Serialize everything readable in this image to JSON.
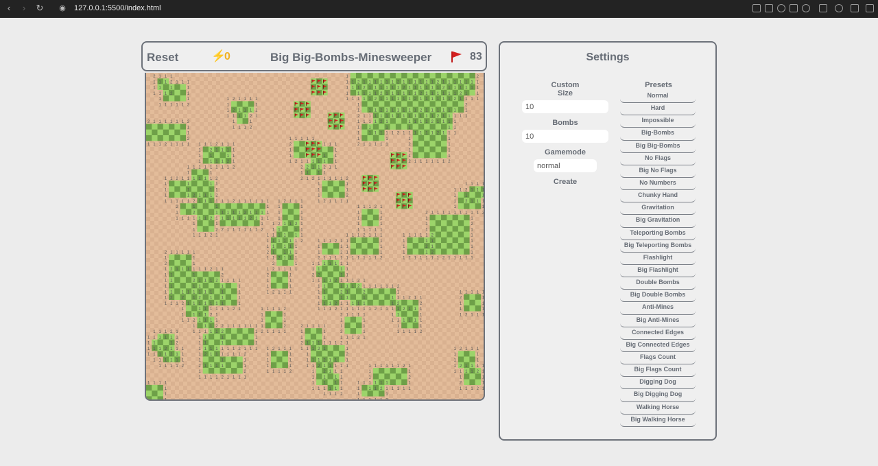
{
  "browser": {
    "url": "127.0.0.1:5500/index.html"
  },
  "topbar": {
    "reset_label": "Reset",
    "lightning_count": "0",
    "title": "Big Big-Bombs-Minesweeper",
    "flags_left": "83"
  },
  "settings": {
    "title": "Settings",
    "custom": {
      "heading": "Custom",
      "size_label": "Size",
      "size_value": "10",
      "bombs_label": "Bombs",
      "bombs_value": "10",
      "gamemode_label": "Gamemode",
      "gamemode_value": "normal",
      "create_label": "Create"
    },
    "presets_heading": "Presets",
    "presets": [
      "Normal",
      "Hard",
      "Impossible",
      "Big-Bombs",
      "Big Big-Bombs",
      "No Flags",
      "Big No Flags",
      "No Numbers",
      "Chunky Hand",
      "Gravitation",
      "Big Gravitation",
      "Teleporting Bombs",
      "Big Teleporting Bombs",
      "Flashlight",
      "Big Flashlight",
      "Double Bombs",
      "Big Double Bombs",
      "Anti-Mines",
      "Big Anti-Mines",
      "Connected Edges",
      "Big Connected Edges",
      "Flags Count",
      "Big Flags Count",
      "Digging Dog",
      "Big Digging Dog",
      "Walking Horse",
      "Big Walking Horse"
    ]
  },
  "colors": {
    "revealed_light": "#e3bc9a",
    "revealed_dark": "#d9b190",
    "hidden_light": "#9cd46a",
    "hidden_dark": "#6ea048",
    "flag_red": "#d42020",
    "accent": "#f0b020"
  },
  "icons": {
    "lightning": "lightning-icon",
    "flag": "flag-icon"
  }
}
